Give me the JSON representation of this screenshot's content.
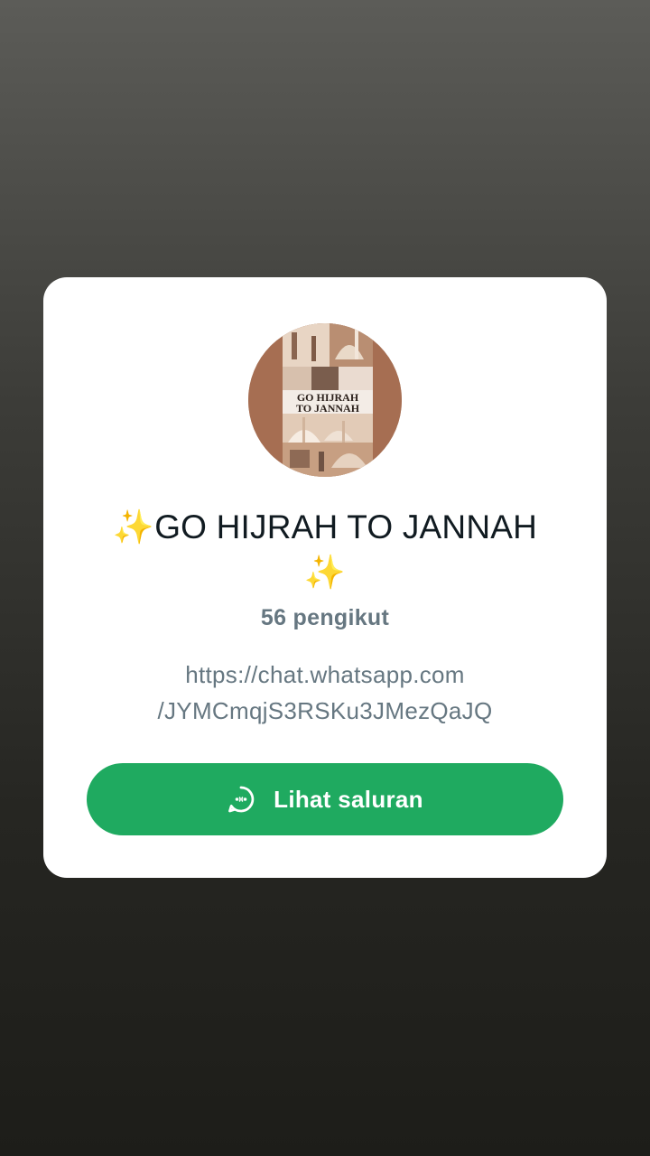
{
  "channel": {
    "title_line1": "✨GO HIJRAH TO JANNAH",
    "title_line2": "✨",
    "followers": "56 pengikut",
    "link_line1": "https://chat.whatsapp.com",
    "link_line2": "/JYMCmqjS3RSKu3JMezQaJQ",
    "avatar_text_line1": "GO HIJRAH",
    "avatar_text_line2": "TO JANNAH"
  },
  "button": {
    "label": "Lihat saluran",
    "icon": "channel-icon"
  },
  "colors": {
    "accent": "#1faa60",
    "card": "#ffffff",
    "title": "#111b21",
    "muted": "#667781"
  }
}
